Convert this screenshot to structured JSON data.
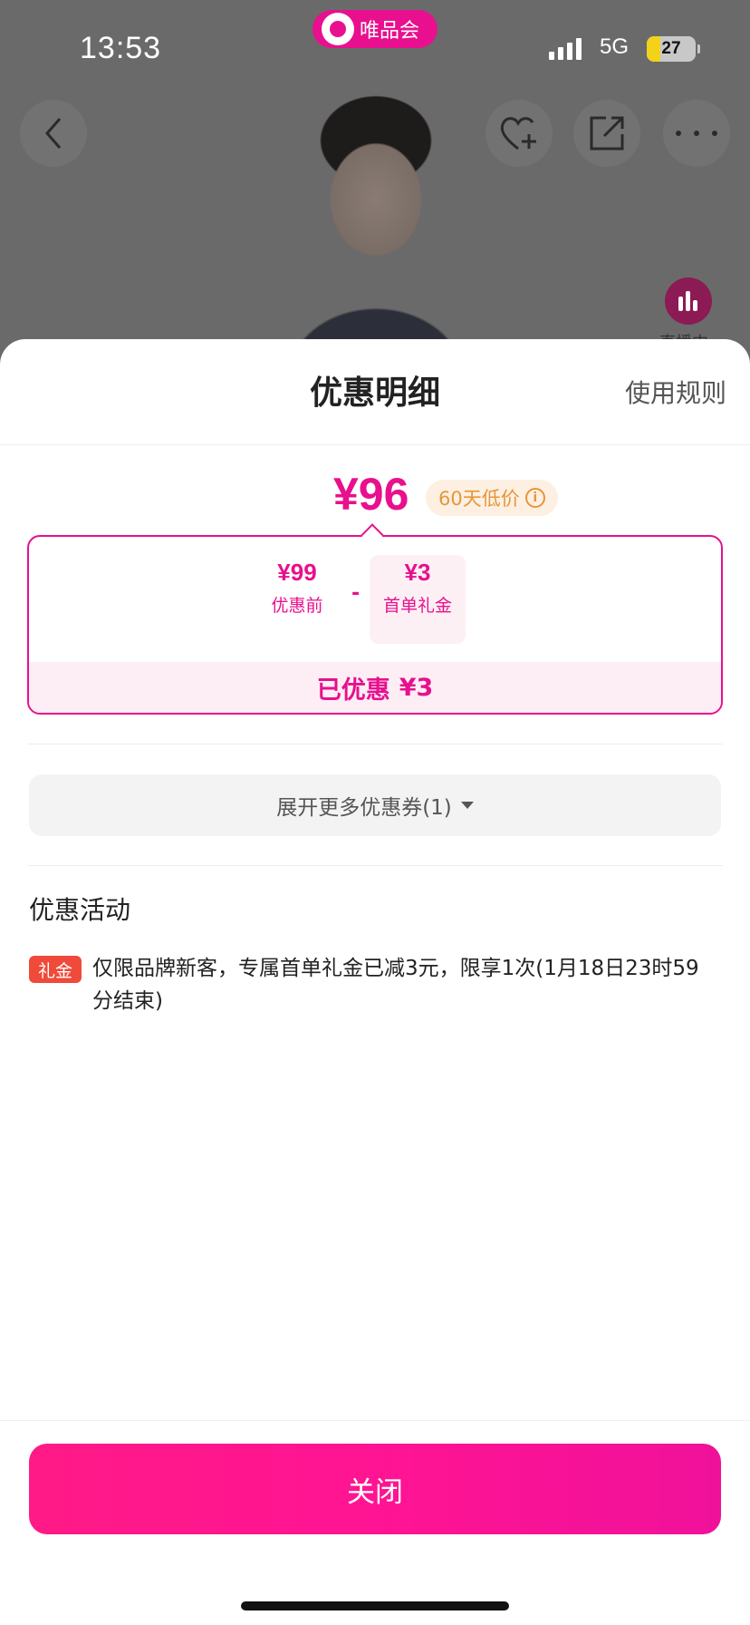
{
  "status_bar": {
    "time": "13:53",
    "network": "5G",
    "battery": "27",
    "battery_level": 0.27
  },
  "app_badge": {
    "name": "唯品会",
    "logo_icon": "bunny-logo-icon",
    "color": "#e8108e"
  },
  "background_page": {
    "back_icon": "back-arrow-icon",
    "favorite_icon": "heart-plus-icon",
    "share_icon": "share-icon",
    "more_icon": "more-dots-icon",
    "live_icon": "live-bars-icon",
    "live_label": "直播中"
  },
  "sheet": {
    "title": "优惠明细",
    "rules_link": "使用规则",
    "final_price": "¥96",
    "low_price_badge": "60天低价",
    "info_icon": "info-icon",
    "breakdown": {
      "original_amount": "¥99",
      "original_label": "优惠前",
      "operator": "-",
      "gift_amount": "¥3",
      "gift_label": "首单礼金",
      "total_label": "已优惠",
      "total_amount": "¥3"
    },
    "expand_coupons": "展开更多优惠券(1)",
    "promotions": {
      "title": "优惠活动",
      "items": [
        {
          "tag": "礼金",
          "text": "仅限品牌新客，专属首单礼金已减3元，限享1次(1月18日23时59分结束)"
        }
      ]
    },
    "close_button": "关闭"
  },
  "colors": {
    "accent": "#e8108e",
    "promo_tag": "#f04a3a",
    "low_badge_text": "#e8953a"
  }
}
